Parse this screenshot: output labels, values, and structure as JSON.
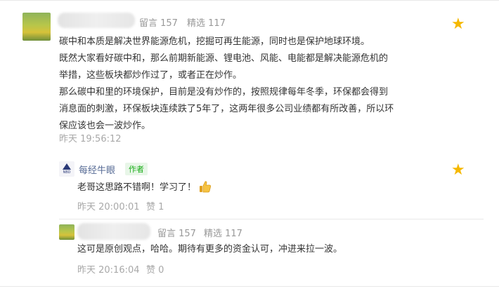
{
  "comment1": {
    "stats": {
      "messages_label": "留言 157",
      "featured_label": "精选 117"
    },
    "lines": [
      "碳中和本质是解决世界能源危机，挖掘可再生能源，同时也是保护地球环境。",
      "既然大家看好碳中和，那么前期新能源、锂电池、风能、电能都是解决能源危机的",
      "举措，这些板块都炒作过了，或者正在炒作。",
      "那么碳中和里的环境保护，目前是没有炒作的，按照规律每年冬季，环保都会得到",
      "消息面的刺激，环保板块连续跌了5年了，这两年很多公司业绩都有所改善，所以环",
      "保应该也会一波炒作。"
    ],
    "time": "昨天 19:56:12"
  },
  "reply1": {
    "author": "每经牛眼",
    "author_badge": "作者",
    "avatar_text": "NBD",
    "text": "老哥这思路不错啊！学习了！",
    "time": "昨天 20:00:01",
    "like_label": "赞 1"
  },
  "reply2": {
    "stats": {
      "messages_label": "留言 157",
      "featured_label": "精选 117"
    },
    "text": "这可是原创观点，哈哈。期待有更多的资金认可，冲进来拉一波。",
    "time": "昨天 20:16:04",
    "like_label": "赞 0"
  },
  "icons": {
    "star": "star-icon",
    "thumbs_up": "thumbs-up-icon"
  },
  "colors": {
    "star": "#f5b800",
    "author_link": "#576b95",
    "badge": "#1aad19"
  }
}
